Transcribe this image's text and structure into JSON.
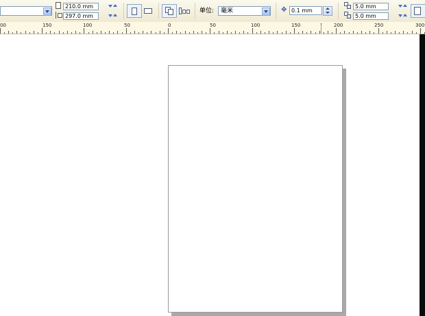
{
  "toolbar": {
    "page_width": "210.0 mm",
    "page_height": "297.0 mm",
    "units_label": "单位:",
    "units_value": "毫米",
    "nudge_value": "0.1 mm",
    "dup_x": "5.0 mm",
    "dup_y": "5.0 mm"
  },
  "ruler": {
    "labels": [
      "00",
      "150",
      "100",
      "50",
      "0",
      "50",
      "100",
      "150",
      "200",
      "250",
      "300"
    ]
  },
  "icons": {
    "page_size_width": "page-width-icon",
    "page_size_height": "page-height-icon",
    "portrait": "portrait-icon",
    "landscape": "landscape-icon",
    "current_page": "current-page-icon",
    "all_pages": "all-pages-icon",
    "nudge": "nudge-icon",
    "dup_x": "duplicate-x-icon",
    "dup_y": "duplicate-y-icon"
  }
}
